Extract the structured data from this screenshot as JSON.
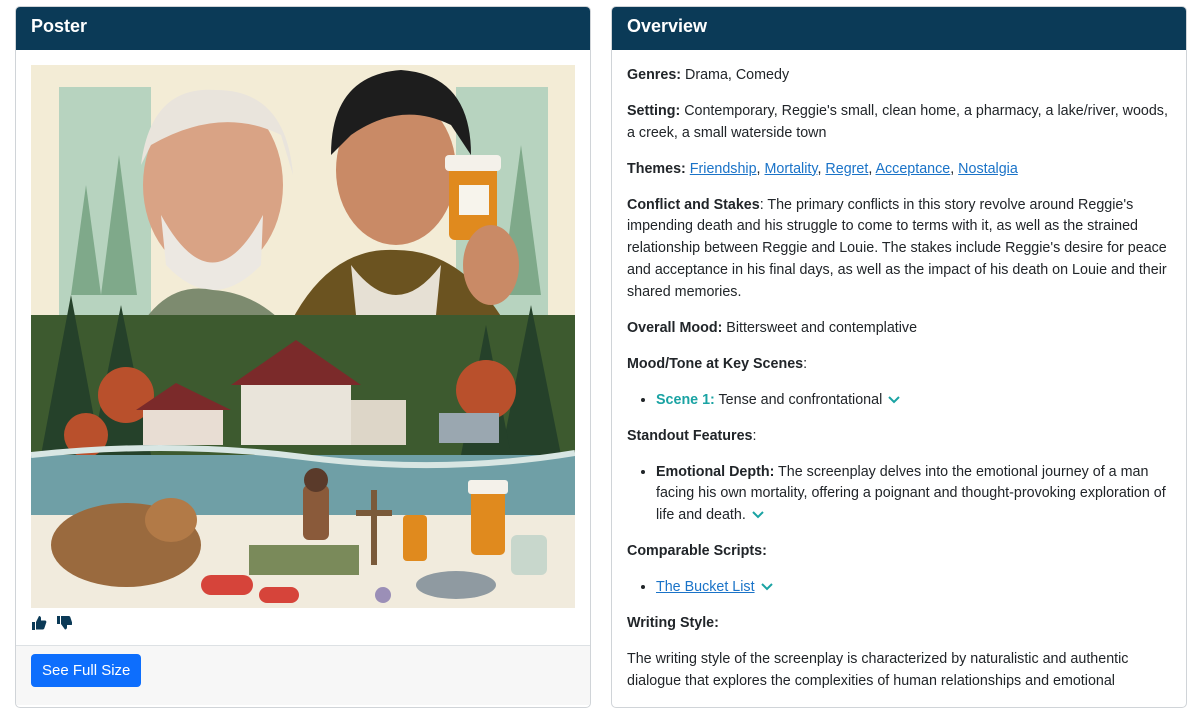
{
  "poster_card": {
    "title": "Poster",
    "full_size_button": "See Full Size",
    "icons": {
      "like": "thumbs-up-icon",
      "dislike": "thumbs-down-icon"
    }
  },
  "overview": {
    "title": "Overview",
    "genres": {
      "label": "Genres:",
      "value": " Drama, Comedy"
    },
    "setting": {
      "label": "Setting:",
      "value": " Contemporary, Reggie's small, clean home, a pharmacy, a lake/river, woods, a creek, a small waterside town"
    },
    "themes": {
      "label": "Themes:",
      "items": [
        "Friendship",
        "Mortality",
        "Regret",
        "Acceptance",
        "Nostalgia"
      ]
    },
    "conflict": {
      "label": "Conflict and Stakes",
      "value": ": The primary conflicts in this story revolve around Reggie's impending death and his struggle to come to terms with it, as well as the strained relationship between Reggie and Louie. The stakes include Reggie's desire for peace and acceptance in his final days, as well as the impact of his death on Louie and their shared memories."
    },
    "mood": {
      "label": "Overall Mood:",
      "value": " Bittersweet and contemplative"
    },
    "mood_tone": {
      "label": "Mood/Tone at Key Scenes",
      "suffix": ":",
      "scene_label": "Scene 1:",
      "scene_value": " Tense and confrontational"
    },
    "standout": {
      "label": "Standout Features",
      "suffix": ":",
      "item_label": "Emotional Depth:",
      "item_value": " The screenplay delves into the emotional journey of a man facing his own mortality, offering a poignant and thought-provoking exploration of life and death."
    },
    "comparable": {
      "label": "Comparable Scripts:",
      "item": "The Bucket List"
    },
    "writing_style": {
      "label": "Writing Style:",
      "value": "The writing style of the screenplay is characterized by naturalistic and authentic dialogue that explores the complexities of human relationships and emotional"
    }
  },
  "colors": {
    "header_bg": "#0b3a57",
    "button_bg": "#0d6efd",
    "link": "#1a73c8",
    "scene_accent": "#1aa3a3"
  }
}
